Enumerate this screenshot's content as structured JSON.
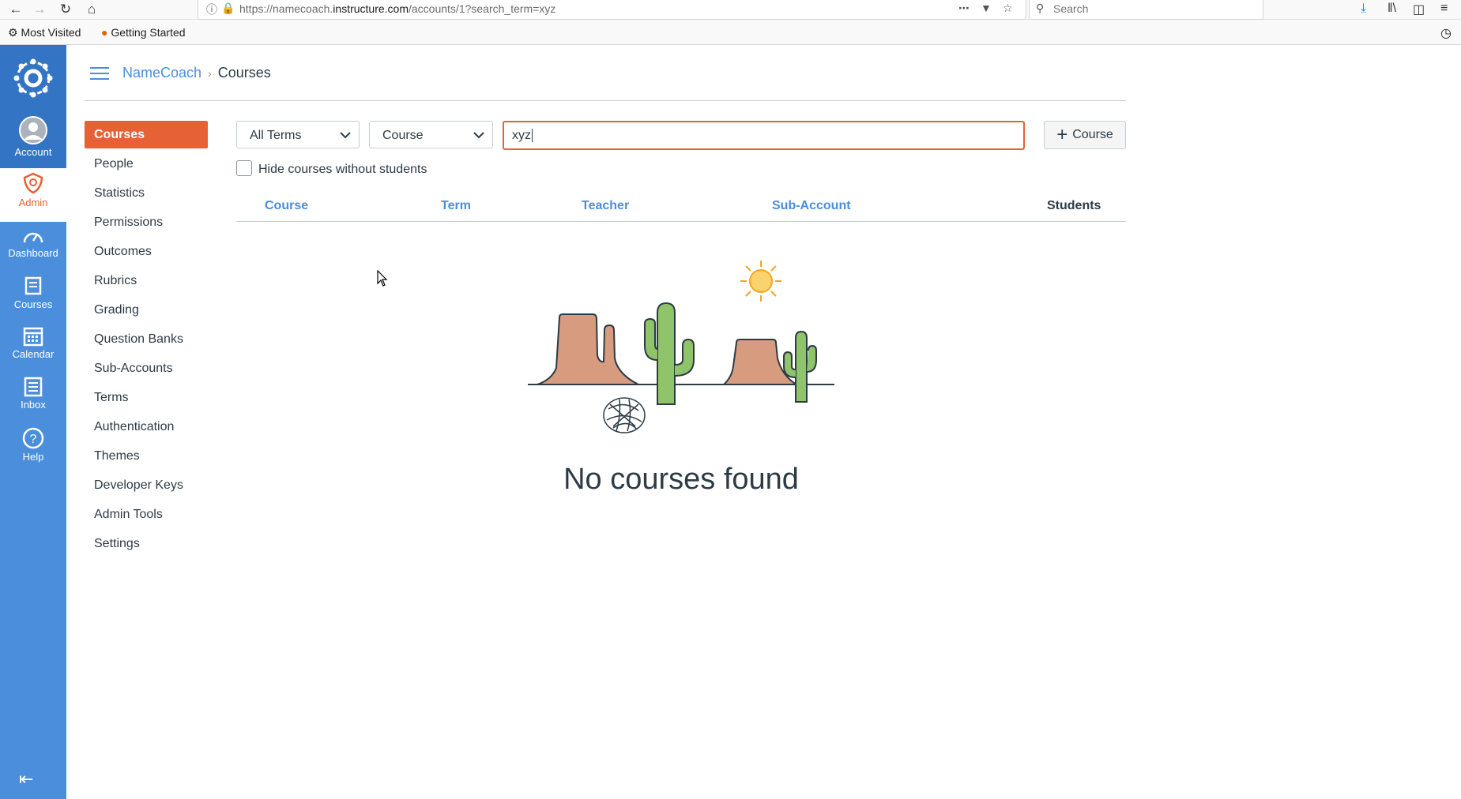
{
  "browser": {
    "url_prefix": "https://namecoach.",
    "url_domain": "instructure.com",
    "url_path": "/accounts/1?search_term=xyz",
    "search_placeholder": "Search",
    "bookmarks": [
      "Most Visited",
      "Getting Started"
    ]
  },
  "global_nav": {
    "items": [
      {
        "label": "Account",
        "icon": "avatar-icon"
      },
      {
        "label": "Admin",
        "icon": "admin-shield-icon",
        "active": true
      },
      {
        "label": "Dashboard",
        "icon": "dashboard-icon"
      },
      {
        "label": "Courses",
        "icon": "courses-icon"
      },
      {
        "label": "Calendar",
        "icon": "calendar-icon"
      },
      {
        "label": "Inbox",
        "icon": "inbox-icon"
      },
      {
        "label": "Help",
        "icon": "help-icon"
      }
    ]
  },
  "breadcrumb": {
    "account": "NameCoach",
    "separator": "›",
    "current": "Courses"
  },
  "sub_nav": {
    "items": [
      "Courses",
      "People",
      "Statistics",
      "Permissions",
      "Outcomes",
      "Rubrics",
      "Grading",
      "Question Banks",
      "Sub-Accounts",
      "Terms",
      "Authentication",
      "Themes",
      "Developer Keys",
      "Admin Tools",
      "Settings"
    ],
    "active": "Courses"
  },
  "filters": {
    "term_select": "All Terms",
    "type_select": "Course",
    "search_value": "xyz",
    "add_course_label": "Course",
    "hide_without_students_label": "Hide courses without students"
  },
  "table": {
    "columns": [
      "Course",
      "Term",
      "Teacher",
      "Sub-Account",
      "Students"
    ]
  },
  "empty_state": {
    "message": "No courses found"
  },
  "colors": {
    "nav_blue": "#4a8edc",
    "accent_orange": "#e66135",
    "text": "#2d3b45"
  }
}
